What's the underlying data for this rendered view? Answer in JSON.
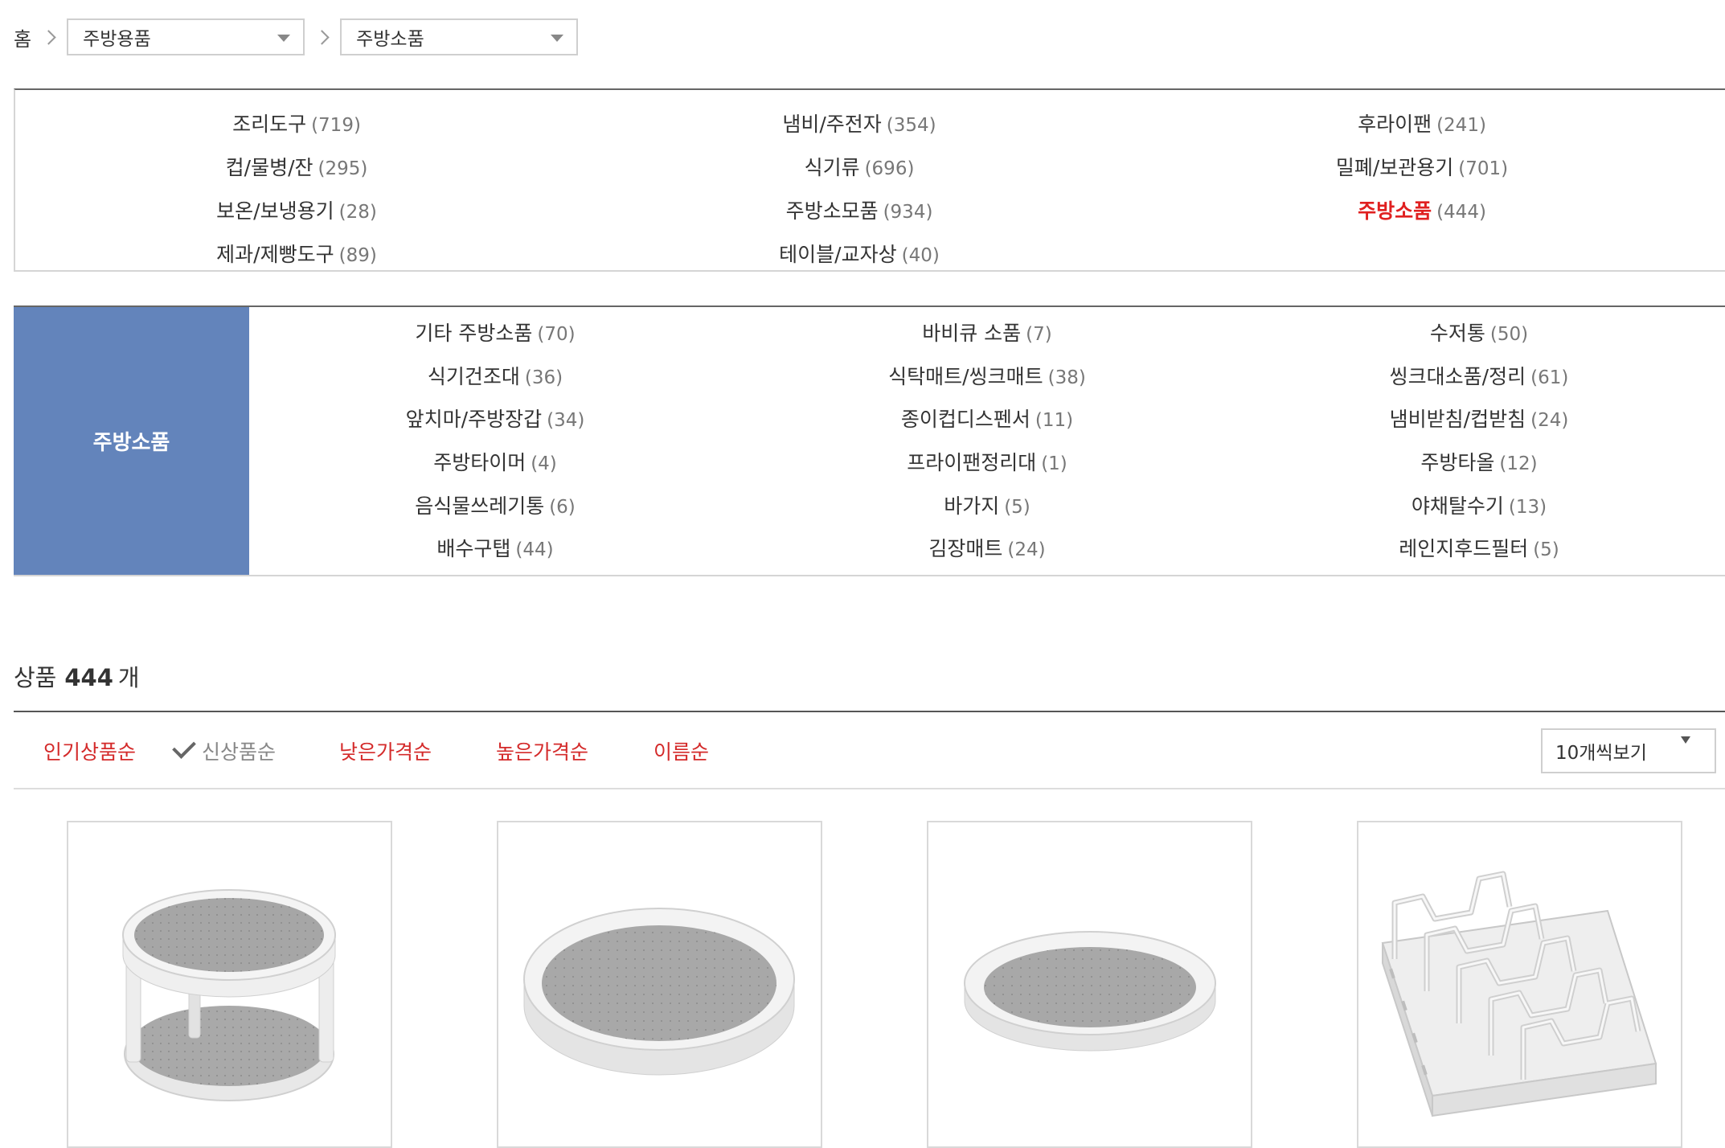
{
  "breadcrumb": {
    "home": "홈",
    "level1": "주방용품",
    "level2": "주방소품"
  },
  "categories": [
    {
      "label": "조리도구",
      "count": "(719)"
    },
    {
      "label": "냄비/주전자",
      "count": "(354)"
    },
    {
      "label": "후라이팬",
      "count": "(241)"
    },
    {
      "label": "컵/물병/잔",
      "count": "(295)"
    },
    {
      "label": "식기류",
      "count": "(696)"
    },
    {
      "label": "밀폐/보관용기",
      "count": "(701)"
    },
    {
      "label": "보온/보냉용기",
      "count": "(28)"
    },
    {
      "label": "주방소모품",
      "count": "(934)"
    },
    {
      "label": "주방소품",
      "count": "(444)",
      "active": true
    },
    {
      "label": "제과/제빵도구",
      "count": "(89)"
    },
    {
      "label": "테이블/교자상",
      "count": "(40)"
    }
  ],
  "subcategory": {
    "title": "주방소품",
    "items": [
      {
        "label": "기타 주방소품",
        "count": "(70)"
      },
      {
        "label": "바비큐 소품",
        "count": "(7)"
      },
      {
        "label": "수저통",
        "count": "(50)"
      },
      {
        "label": "식기건조대",
        "count": "(36)"
      },
      {
        "label": "식탁매트/씽크매트",
        "count": "(38)"
      },
      {
        "label": "씽크대소품/정리",
        "count": "(61)"
      },
      {
        "label": "앞치마/주방장갑",
        "count": "(34)"
      },
      {
        "label": "종이컵디스펜서",
        "count": "(11)"
      },
      {
        "label": "냄비받침/컵받침",
        "count": "(24)"
      },
      {
        "label": "주방타이머",
        "count": "(4)"
      },
      {
        "label": "프라이팬정리대",
        "count": "(1)"
      },
      {
        "label": "주방타올",
        "count": "(12)"
      },
      {
        "label": "음식물쓰레기통",
        "count": "(6)"
      },
      {
        "label": "바가지",
        "count": "(5)"
      },
      {
        "label": "야채탈수기",
        "count": "(13)"
      },
      {
        "label": "배수구탭",
        "count": "(44)"
      },
      {
        "label": "김장매트",
        "count": "(24)"
      },
      {
        "label": "레인지후드필터",
        "count": "(5)"
      }
    ]
  },
  "product_count": {
    "prefix": "상품",
    "number": "444",
    "suffix": "개"
  },
  "sort": {
    "options": [
      "인기상품순",
      "신상품순",
      "낮은가격순",
      "높은가격순",
      "이름순"
    ],
    "selected": "신상품순"
  },
  "view_select": {
    "value": "10개씩보기"
  },
  "products": [
    {
      "image": "two-tier-turntable"
    },
    {
      "image": "large-turntable"
    },
    {
      "image": "small-turntable"
    },
    {
      "image": "pan-lid-rack"
    }
  ],
  "colors": {
    "accent_red": "#e02020",
    "sort_red": "#d42a2a",
    "side_blue": "#6384bb"
  }
}
